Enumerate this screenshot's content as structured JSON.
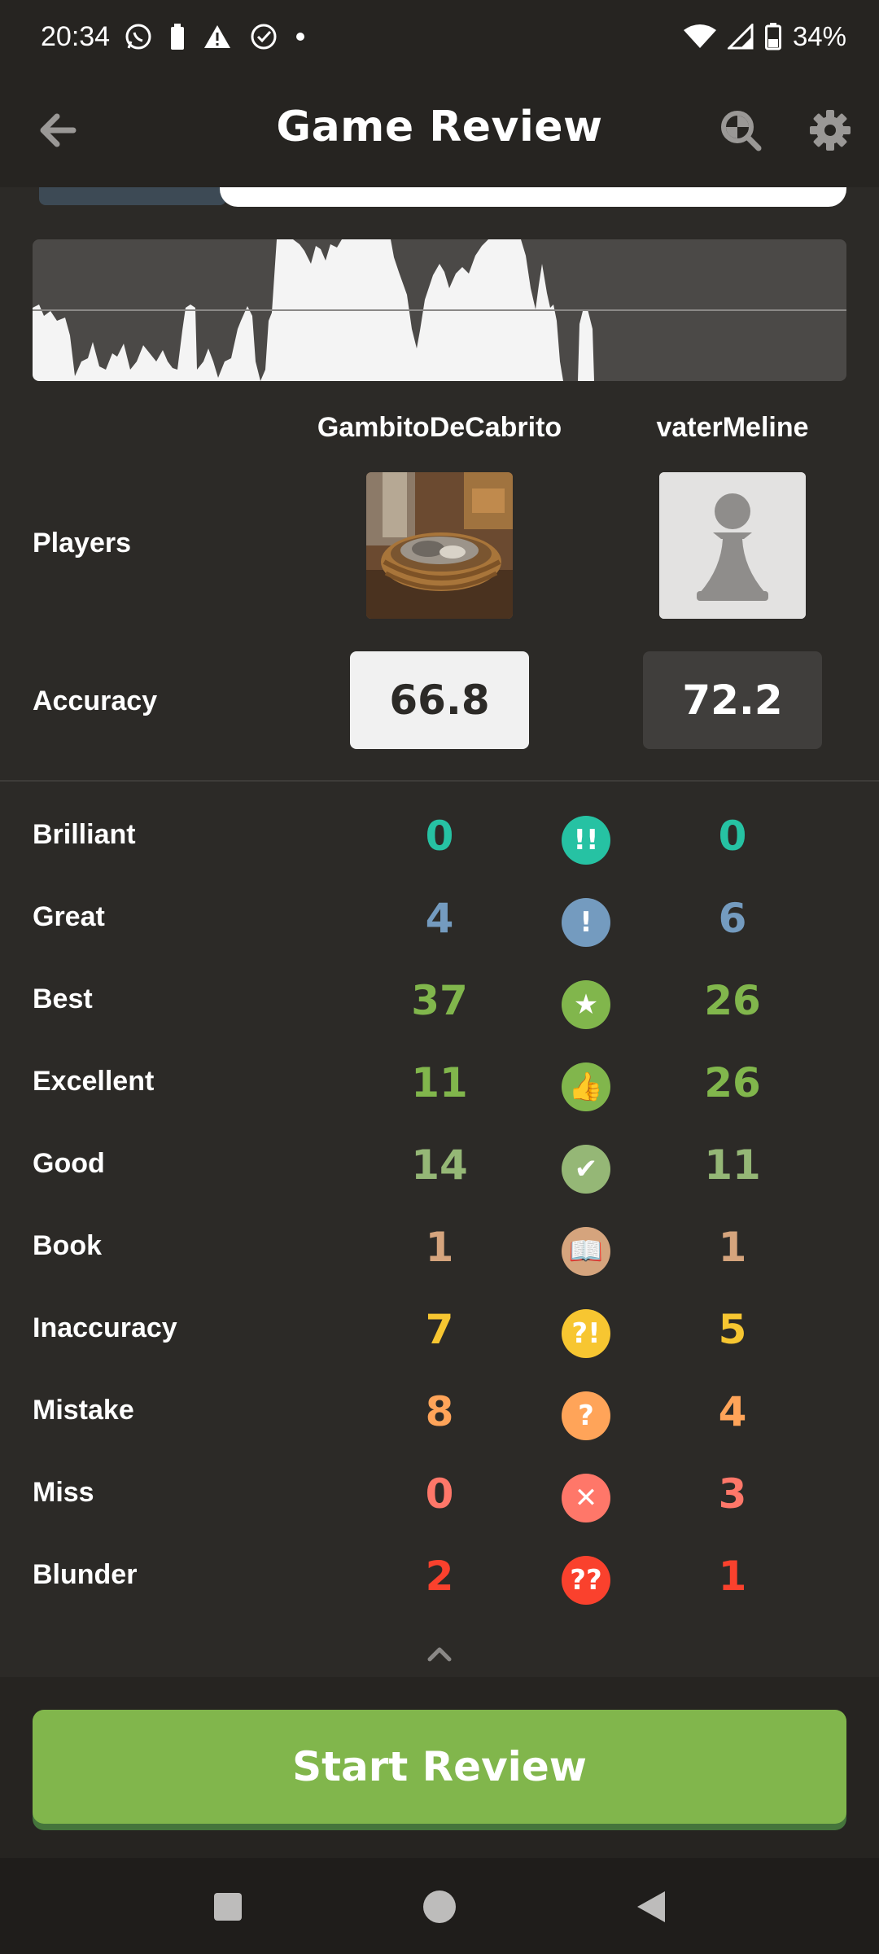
{
  "status_bar": {
    "time": "20:34",
    "battery": "34%",
    "icons_left": [
      "whatsapp-icon",
      "battery-saver-icon",
      "warning-icon",
      "check-circle-icon",
      "dot-icon"
    ],
    "icons_right": [
      "wifi-icon",
      "signal-icon",
      "battery-icon"
    ]
  },
  "header": {
    "title": "Game Review",
    "icons": [
      "back-arrow-icon",
      "analysis-search-icon",
      "settings-gear-icon"
    ]
  },
  "players": {
    "label": "Players",
    "white": {
      "name": "GambitoDeCabrito",
      "avatar": "cat-in-basket-photo"
    },
    "black": {
      "name": "vaterMeline",
      "avatar": "pawn-placeholder"
    }
  },
  "accuracy": {
    "label": "Accuracy",
    "white": "66.8",
    "black": "72.2"
  },
  "stats": [
    {
      "label": "Brilliant",
      "white": "0",
      "black": "0",
      "icon": "!!",
      "icon_name": "brilliant-icon",
      "color": "#26c2a3"
    },
    {
      "label": "Great",
      "white": "4",
      "black": "6",
      "icon": "!",
      "icon_name": "great-icon",
      "color": "#749bbf"
    },
    {
      "label": "Best",
      "white": "37",
      "black": "26",
      "icon": "★",
      "icon_name": "best-star-icon",
      "color": "#81b64c"
    },
    {
      "label": "Excellent",
      "white": "11",
      "black": "26",
      "icon": "👍",
      "icon_name": "excellent-thumbs-up-icon",
      "color": "#81b64c"
    },
    {
      "label": "Good",
      "white": "14",
      "black": "11",
      "icon": "✔",
      "icon_name": "good-check-icon",
      "color": "#95b776"
    },
    {
      "label": "Book",
      "white": "1",
      "black": "1",
      "icon": "📖",
      "icon_name": "book-icon",
      "color": "#d5a47d"
    },
    {
      "label": "Inaccuracy",
      "white": "7",
      "black": "5",
      "icon": "?!",
      "icon_name": "inaccuracy-icon",
      "color": "#f7c631"
    },
    {
      "label": "Mistake",
      "white": "8",
      "black": "4",
      "icon": "?",
      "icon_name": "mistake-icon",
      "color": "#ffa459"
    },
    {
      "label": "Miss",
      "white": "0",
      "black": "3",
      "icon": "✕",
      "icon_name": "miss-x-icon",
      "color": "#ff7769"
    },
    {
      "label": "Blunder",
      "white": "2",
      "black": "1",
      "icon": "??",
      "icon_name": "blunder-icon",
      "color": "#fa412d"
    }
  ],
  "action": {
    "start_review": "Start Review"
  },
  "nav": [
    "recent-apps-square-icon",
    "home-circle-icon",
    "back-triangle-icon"
  ],
  "colors": {
    "background": "#2c2a27",
    "header": "#262421",
    "accent_green": "#81b64c"
  }
}
